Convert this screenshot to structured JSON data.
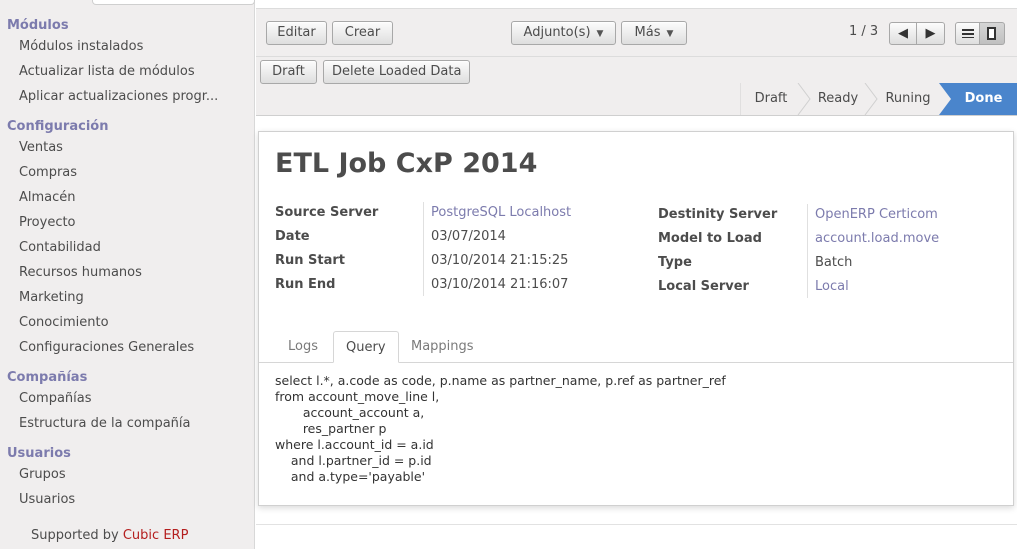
{
  "sidebar": {
    "sections": [
      {
        "title": "Módulos",
        "items": [
          "Módulos instalados",
          "Actualizar lista de módulos",
          "Aplicar actualizaciones progr..."
        ]
      },
      {
        "title": "Configuración",
        "items": [
          "Ventas",
          "Compras",
          "Almacén",
          "Proyecto",
          "Contabilidad",
          "Recursos humanos",
          "Marketing",
          "Conocimiento",
          "Configuraciones Generales"
        ]
      },
      {
        "title": "Compañías",
        "items": [
          "Compañías",
          "Estructura de la compañía"
        ]
      },
      {
        "title": "Usuarios",
        "items": [
          "Grupos",
          "Usuarios"
        ]
      }
    ],
    "footer_prefix": "Supported by",
    "footer_brand": "Cubic ERP"
  },
  "toolbar": {
    "edit_label": "Editar",
    "create_label": "Crear",
    "attachments_label": "Adjunto(s)",
    "more_label": "Más",
    "pager": "1 / 3",
    "prev_icon": "arrow-left-icon",
    "next_icon": "arrow-right-icon",
    "list_view_icon": "list-view-icon",
    "form_view_icon": "form-view-icon"
  },
  "header_buttons": {
    "draft_label": "Draft",
    "delete_loaded_label": "Delete Loaded Data"
  },
  "statusbar": {
    "states": [
      "Draft",
      "Ready",
      "Runing",
      "Done"
    ],
    "active": "Done",
    "active_color": "#4a85cc"
  },
  "record": {
    "title": "ETL Job CxP 2014",
    "left_fields": [
      {
        "label": "Source Server",
        "value": "PostgreSQL Localhost"
      },
      {
        "label": "Date",
        "value": "03/07/2014"
      },
      {
        "label": "Run Start",
        "value": "03/10/2014 21:15:25"
      },
      {
        "label": "Run End",
        "value": "03/10/2014 21:16:07"
      }
    ],
    "right_fields": [
      {
        "label": "Destinity Server",
        "value": "OpenERP Certicom"
      },
      {
        "label": "Model to Load",
        "value": "account.load.move"
      },
      {
        "label": "Type",
        "value": "Batch"
      },
      {
        "label": "Local Server",
        "value": "Local"
      }
    ]
  },
  "tabs": {
    "items": [
      "Logs",
      "Query",
      "Mappings"
    ],
    "active": "Query"
  },
  "query_text": "select l.*, a.code as code, p.name as partner_name, p.ref as partner_ref\nfrom account_move_line l,\n       account_account a,\n       res_partner p\nwhere l.account_id = a.id\n    and l.partner_id = p.id\n    and a.type='payable'",
  "colors": {
    "sidebar_section": "#7c7bad",
    "link": "#7c7bad",
    "brand": "#b41e1e"
  }
}
